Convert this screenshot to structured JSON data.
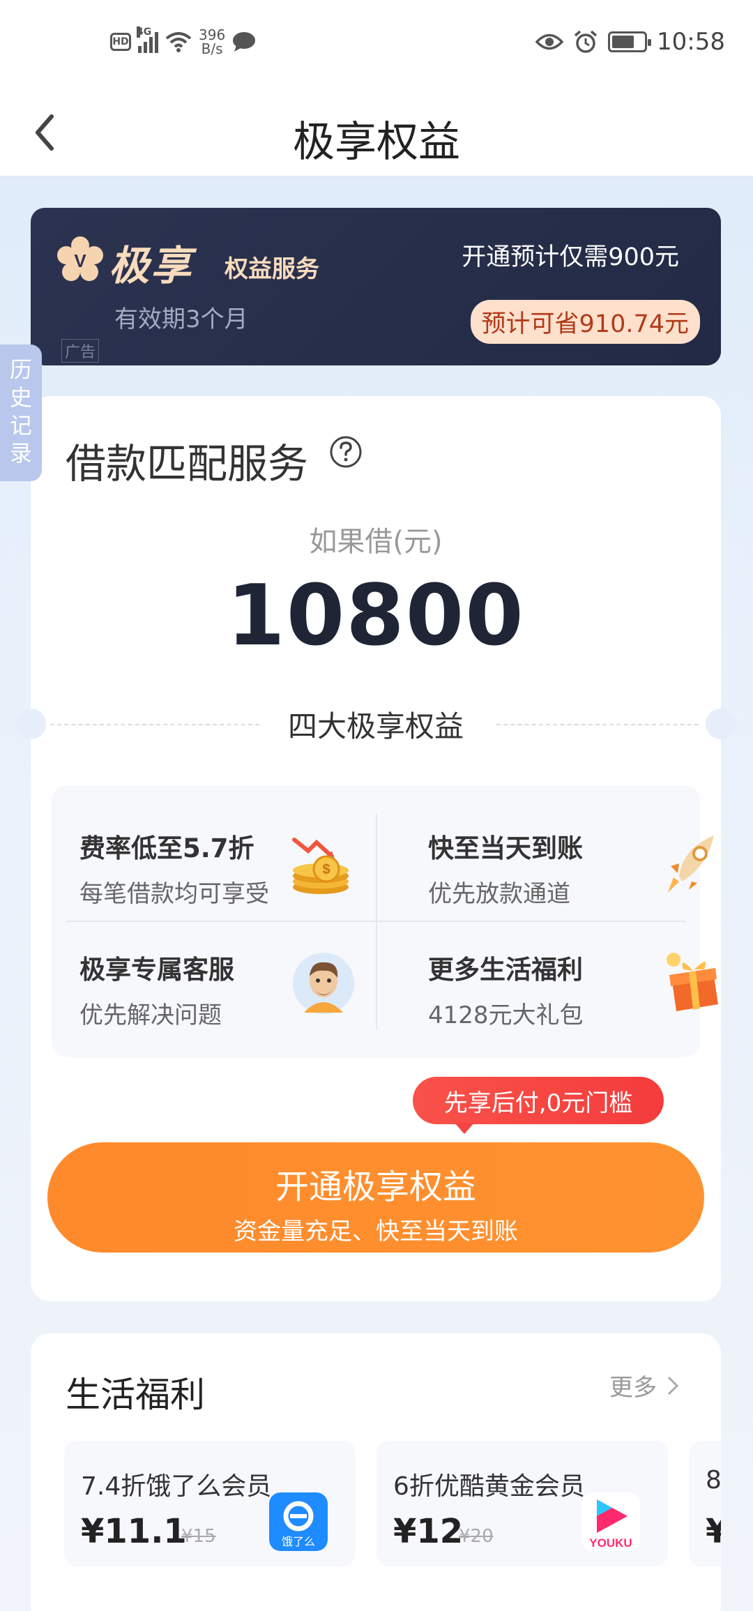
{
  "status_bar": {
    "hd": "HD",
    "network": "4G",
    "speed_value": "396",
    "speed_unit": "B/s",
    "time": "10:58"
  },
  "nav": {
    "title": "极享权益"
  },
  "promo": {
    "brand_name": "极享",
    "brand_sub": "权益服务",
    "validity": "有效期3个月",
    "ad_tag": "广告",
    "price_text": "开通预计仅需900元",
    "save_text": "预计可省910.74元"
  },
  "history_tab": {
    "label": "历史记录"
  },
  "main": {
    "title": "借款匹配服务",
    "borrow_label": "如果借(元)",
    "borrow_amount": "10800",
    "section_label": "四大极享权益",
    "benefits": [
      {
        "title": "费率低至5.7折",
        "desc": "每笔借款均可享受",
        "icon": "coins-icon"
      },
      {
        "title": "快至当天到账",
        "desc": "优先放款通道",
        "icon": "rocket-icon"
      },
      {
        "title": "极享专属客服",
        "desc": "优先解决问题",
        "icon": "service-avatar-icon"
      },
      {
        "title": "更多生活福利",
        "desc": "4128元大礼包",
        "icon": "gift-box-icon"
      }
    ],
    "tooltip": "先享后付,0元门槛",
    "button_main": "开通极享权益",
    "button_sub": "资金量充足、快至当天到账"
  },
  "life": {
    "title": "生活福利",
    "more": "更多",
    "offers": [
      {
        "name": "7.4折饿了么会员",
        "price": "¥11.1",
        "original": "¥15",
        "logo_text": "饿了么",
        "logo_color": "#1e8bff"
      },
      {
        "name": "6折优酷黄金会员",
        "price": "¥12",
        "original": "¥20",
        "logo_text": "YOUKU",
        "logo_color": "#ff2a6d"
      },
      {
        "name": "8",
        "price": "¥",
        "original": ""
      }
    ]
  },
  "colors": {
    "accent_orange": "#ff8a2b",
    "banner_navy": "#252c48",
    "badge_red": "#f54442",
    "gold_text": "#f8dcbd"
  }
}
